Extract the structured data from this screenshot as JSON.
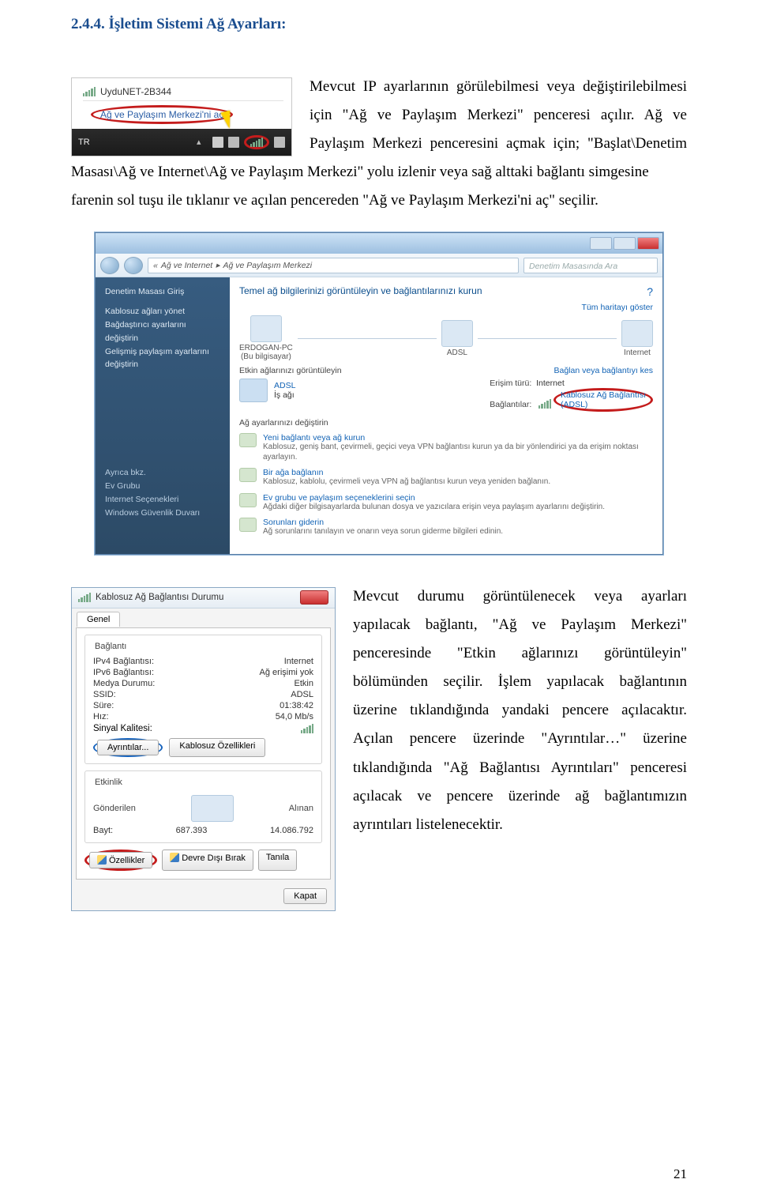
{
  "heading": "2.4.4.   İşletim Sistemi Ağ Ayarları:",
  "para1_1": "Mevcut IP ayarlarının görülebilmesi veya değiştirilebilmesi için \"Ağ ve Paylaşım Merkezi\" penceresi açılır. Ağ ve Paylaşım Merkezi penceresini açmak için; \"Başlat\\Denetim Masası\\Ağ ve Internet\\Ağ ve Paylaşım Merkezi\" yolu izlenir veya sağ alttaki bağlantı simgesine",
  "para1_2": "farenin sol tuşu ile tıklanır ve açılan pencereden \"Ağ ve Paylaşım Merkezi'ni aç\" seçilir.",
  "para2": "Mevcut durumu görüntülenecek veya ayarları yapılacak bağlantı, \"Ağ ve Paylaşım Merkezi\" penceresinde \"Etkin ağlarınızı görüntüleyin\" bölümünden seçilir. İşlem yapılacak bağlantının üzerine tıklandığında yandaki pencere açılacaktır. Açılan pencere üzerinde \"Ayrıntılar…\" üzerine tıklandığında \"Ağ Bağlantısı Ayrıntıları\" penceresi açılacak ve pencere üzerinde ağ bağlantımızın ayrıntıları listelenecektir.",
  "page_number": "21",
  "tray": {
    "ssid": "UyduNET-2B344",
    "tooltip": "Ağ ve Paylaşım Merkezi'ni aç",
    "lang": "TR"
  },
  "cp": {
    "path_prefix": "«",
    "path_1": "Ağ ve Internet",
    "path_sep": "▸",
    "path_2": "Ağ ve Paylaşım Merkezi",
    "search_placeholder": "Denetim Masasında Ara",
    "side": {
      "home": "Denetim Masası Giriş",
      "i1": "Kablosuz ağları yönet",
      "i2": "Bağdaştırıcı ayarlarını değiştirin",
      "i3": "Gelişmiş paylaşım ayarlarını değiştirin",
      "see": "Ayrıca bkz.",
      "s1": "Ev Grubu",
      "s2": "Internet Seçenekleri",
      "s3": "Windows Güvenlik Duvarı"
    },
    "main": {
      "heading": "Temel ağ bilgilerinizi görüntüleyin ve bağlantılarınızı kurun",
      "fullmap": "Tüm haritayı göster",
      "node1a": "ERDOGAN-PC",
      "node1b": "(Bu bilgisayar)",
      "node2": "ADSL",
      "node3": "Internet",
      "row_view": "Etkin ağlarınızı görüntüleyin",
      "row_disconnect": "Bağlan veya bağlantıyı kes",
      "net_name": "ADSL",
      "net_type": "İş ağı",
      "k_access": "Erişim türü:",
      "v_access": "Internet",
      "k_conns": "Bağlantılar:",
      "v_conns": "Kablosuz Ağ Bağlantısı",
      "v_conns2": "(ADSL)",
      "h_change": "Ağ ayarlarınızı değiştirin",
      "t1": "Yeni bağlantı veya ağ kurun",
      "t1d": "Kablosuz, geniş bant, çevirmeli, geçici veya VPN bağlantısı kurun ya da bir yönlendirici ya da erişim noktası ayarlayın.",
      "t2": "Bir ağa bağlanın",
      "t2d": "Kablosuz, kablolu, çevirmeli veya VPN ağ bağlantısı kurun veya yeniden bağlanın.",
      "t3": "Ev grubu ve paylaşım seçeneklerini seçin",
      "t3d": "Ağdaki diğer bilgisayarlarda bulunan dosya ve yazıcılara erişin veya paylaşım ayarlarını değiştirin.",
      "t4": "Sorunları giderin",
      "t4d": "Ağ sorunlarını tanılayın ve onarın veya sorun giderme bilgileri edinin."
    }
  },
  "dlg": {
    "title": "Kablosuz Ağ Bağlantısı Durumu",
    "tab": "Genel",
    "fs1": "Bağlantı",
    "k_ipv4": "IPv4 Bağlantısı:",
    "v_ipv4": "Internet",
    "k_ipv6": "IPv6 Bağlantısı:",
    "v_ipv6": "Ağ erişimi yok",
    "k_media": "Medya Durumu:",
    "v_media": "Etkin",
    "k_ssid": "SSID:",
    "v_ssid": "ADSL",
    "k_dur": "Süre:",
    "v_dur": "01:38:42",
    "k_speed": "Hız:",
    "v_speed": "54,0 Mb/s",
    "k_sig": "Sinyal Kalitesi:",
    "btn_details": "Ayrıntılar...",
    "btn_wprops": "Kablosuz Özellikleri",
    "fs2": "Etkinlik",
    "sent": "Gönderilen",
    "recv": "Alınan",
    "bytes_label": "Bayt:",
    "bytes_sent": "687.393",
    "bytes_recv": "14.086.792",
    "btn_props": "Özellikler",
    "btn_disable": "Devre Dışı Bırak",
    "btn_diag": "Tanıla",
    "btn_close": "Kapat"
  }
}
